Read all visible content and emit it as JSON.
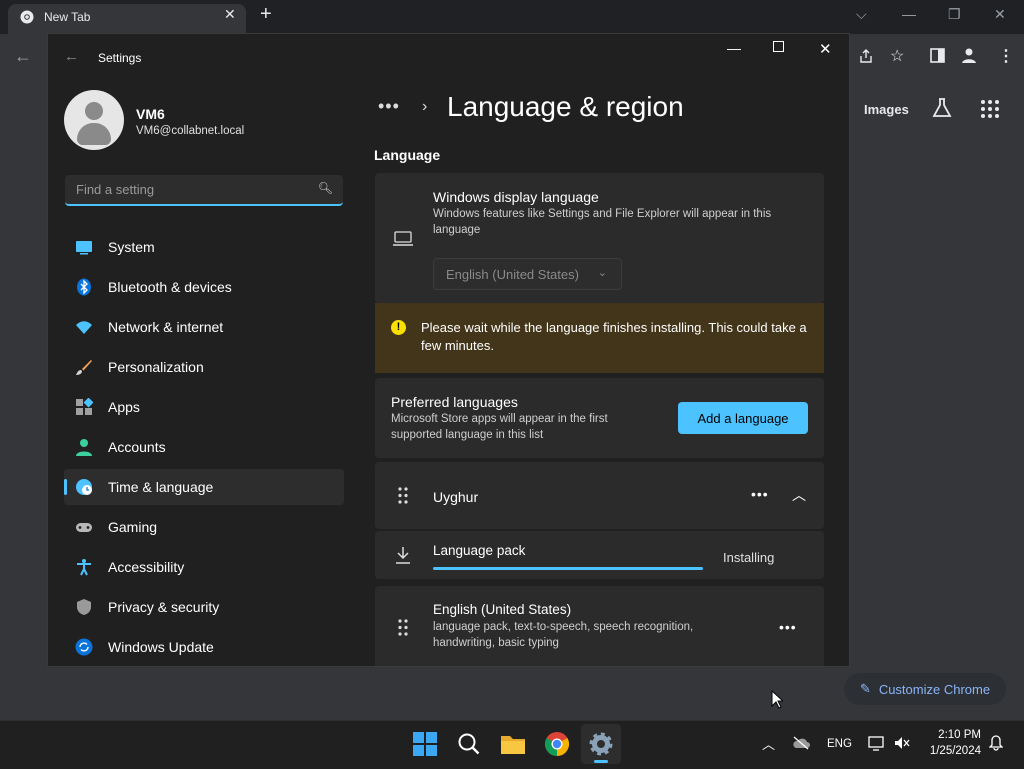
{
  "chrome": {
    "tab_title": "New Tab",
    "images_link": "Images",
    "customize_label": "Customize Chrome"
  },
  "settings": {
    "window_title": "Settings",
    "user": {
      "name": "VM6",
      "email": "VM6@collabnet.local"
    },
    "search": {
      "placeholder": "Find a setting",
      "value": ""
    },
    "nav": [
      {
        "label": "System",
        "icon": "monitor-icon"
      },
      {
        "label": "Bluetooth & devices",
        "icon": "bluetooth-icon"
      },
      {
        "label": "Network & internet",
        "icon": "wifi-icon"
      },
      {
        "label": "Personalization",
        "icon": "brush-icon"
      },
      {
        "label": "Apps",
        "icon": "apps-icon"
      },
      {
        "label": "Accounts",
        "icon": "person-icon"
      },
      {
        "label": "Time & language",
        "icon": "globe-clock-icon",
        "active": true
      },
      {
        "label": "Gaming",
        "icon": "gamepad-icon"
      },
      {
        "label": "Accessibility",
        "icon": "accessibility-icon"
      },
      {
        "label": "Privacy & security",
        "icon": "shield-icon"
      },
      {
        "label": "Windows Update",
        "icon": "update-icon"
      }
    ],
    "breadcrumb": {
      "ellipsis": "•••",
      "separator": "›",
      "title": "Language & region"
    },
    "section_title": "Language",
    "display_language": {
      "label": "Windows display language",
      "description": "Windows features like Settings and File Explorer will appear in this language",
      "selected": "English (United States)"
    },
    "warning": "Please wait while the language finishes installing. This could take a few minutes.",
    "preferred": {
      "label": "Preferred languages",
      "description": "Microsoft Store apps will appear in the first supported language in this list",
      "button": "Add a language"
    },
    "languages": [
      {
        "name": "Uyghur",
        "expanded": true,
        "subitem": {
          "label": "Language pack",
          "status": "Installing",
          "progress": 1.0
        }
      },
      {
        "name": "English (United States)",
        "description": "language pack, text-to-speech, speech recognition, handwriting, basic typing"
      }
    ]
  },
  "taskbar": {
    "language": "ENG",
    "time": "2:10 PM",
    "date": "1/25/2024"
  },
  "colors": {
    "accent": "#4cc2ff",
    "warning_bg": "#433519",
    "warning_icon": "#fce100"
  }
}
